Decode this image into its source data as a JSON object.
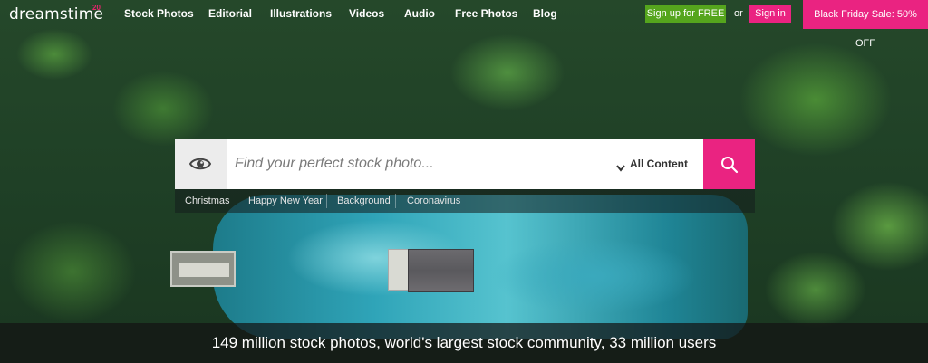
{
  "brand": {
    "logo_text": "dreamstime",
    "logo_badge": "20",
    "accent_color": "#ea2381",
    "signup_color": "#55a51d"
  },
  "nav": {
    "items": [
      "Stock Photos",
      "Editorial",
      "Illustrations",
      "Videos",
      "Audio",
      "Free Photos",
      "Blog"
    ]
  },
  "auth": {
    "signup_label": "Sign up for FREE",
    "or_label": "or",
    "signin_label": "Sign in"
  },
  "promo": {
    "label": "Black Friday Sale: 50% OFF"
  },
  "search": {
    "placeholder": "Find your perfect stock photo...",
    "value": "",
    "scope_label": "All Content",
    "left_icon": "eye-icon",
    "button_icon": "search-icon"
  },
  "tags": [
    "Christmas",
    "Happy New Year",
    "Background",
    "Coronavirus"
  ],
  "stats": {
    "text": "149 million stock photos, world's largest stock community, 33 million users"
  }
}
